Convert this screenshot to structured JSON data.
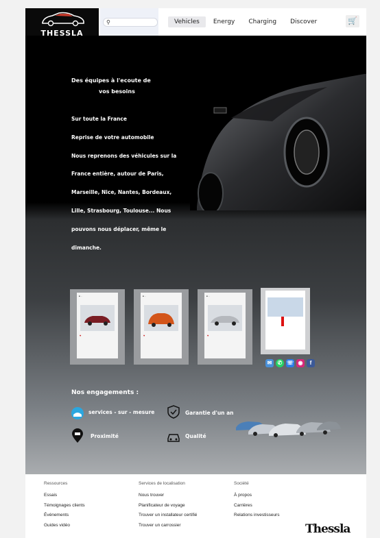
{
  "header": {
    "brand": "THESSLA",
    "search": {
      "placeholder": ""
    },
    "nav": [
      "Vehicles",
      "Energy",
      "Charging",
      "Discover"
    ],
    "active_nav": "Vehicles",
    "cart_icon": "cart-icon"
  },
  "hero": {
    "tagline": "",
    "title_line1": "Des équipes à l'ecoute de",
    "title_line2": "vos besoins",
    "lines": [
      "Sur toute la France",
      "Reprise de votre automobile",
      "Nous reprenons des véhicules sur la",
      "France entière, autour de Paris,",
      "Marseille, Nice, Nantes, Bordeaux,",
      "Lille, Strasbourg, Toulouse... Nous",
      "pouvons nous déplacer, même le",
      "dimanche."
    ]
  },
  "posts": {
    "colors": [
      "#7a1d24",
      "#d3551a",
      "#b5b8bd"
    ],
    "social_icons": [
      "mail-icon",
      "whatsapp-icon",
      "phone-icon",
      "instagram-icon",
      "facebook-icon"
    ]
  },
  "engagements": {
    "title": "Nos engagements :",
    "items": [
      "services - sur - mesure",
      "Garantie d'un an",
      "Proximité",
      "Qualité"
    ]
  },
  "footer": {
    "columns": [
      {
        "title": "Ressources",
        "links": [
          "Essais",
          "Témoignages clients",
          "Événements",
          "Guides vidéo"
        ]
      },
      {
        "title": "Services de localisation",
        "links": [
          "Nous trouver",
          "Planificateur de voyage",
          "Trouver un installateur certifié",
          "Trouver un carrossier"
        ]
      },
      {
        "title": "Société",
        "links": [
          "À propos",
          "Carrières",
          "Relations investisseurs"
        ]
      }
    ],
    "signature": "Thessla"
  }
}
